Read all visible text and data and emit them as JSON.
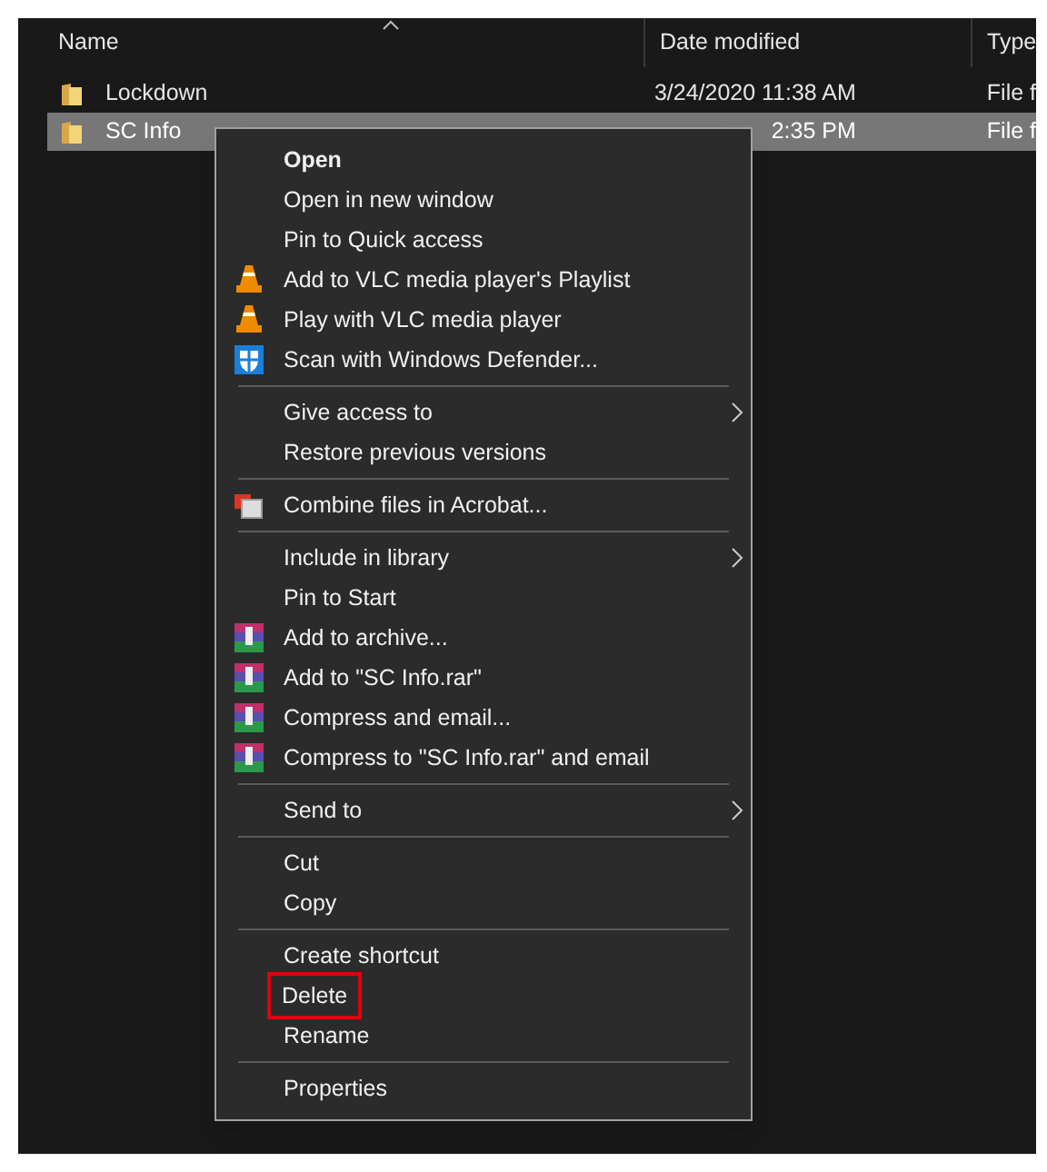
{
  "columns": [
    {
      "label": "Name",
      "sorted": true
    },
    {
      "label": "Date modified"
    },
    {
      "label": "Type"
    }
  ],
  "files": [
    {
      "name": "Lockdown",
      "date": "3/24/2020 11:38 AM",
      "type": "File f",
      "selected": false
    },
    {
      "name": "SC Info",
      "date": "2:35 PM",
      "type": "File f",
      "selected": true
    }
  ],
  "context_menu": {
    "groups": [
      [
        {
          "label": "Open",
          "default": true
        },
        {
          "label": "Open in new window"
        },
        {
          "label": "Pin to Quick access"
        },
        {
          "label": "Add to VLC media player's Playlist",
          "kind": "vlc"
        },
        {
          "label": "Play with VLC media player",
          "kind": "vlc"
        },
        {
          "label": "Scan with Windows Defender...",
          "kind": "defender"
        }
      ],
      [
        {
          "label": "Give access to",
          "submenu": true
        },
        {
          "label": "Restore previous versions"
        }
      ],
      [
        {
          "label": "Combine files in Acrobat...",
          "kind": "acrobat"
        }
      ],
      [
        {
          "label": "Include in library",
          "submenu": true
        },
        {
          "label": "Pin to Start"
        },
        {
          "label": "Add to archive...",
          "kind": "winrar"
        },
        {
          "label": "Add to \"SC Info.rar\"",
          "kind": "winrar"
        },
        {
          "label": "Compress and email...",
          "kind": "winrar"
        },
        {
          "label": "Compress to \"SC Info.rar\" and email",
          "kind": "winrar"
        }
      ],
      [
        {
          "label": "Send to",
          "submenu": true
        }
      ],
      [
        {
          "label": "Cut"
        },
        {
          "label": "Copy"
        }
      ],
      [
        {
          "label": "Create shortcut"
        },
        {
          "label": "Delete",
          "highlighted": true
        },
        {
          "label": "Rename"
        }
      ],
      [
        {
          "label": "Properties"
        }
      ]
    ]
  }
}
